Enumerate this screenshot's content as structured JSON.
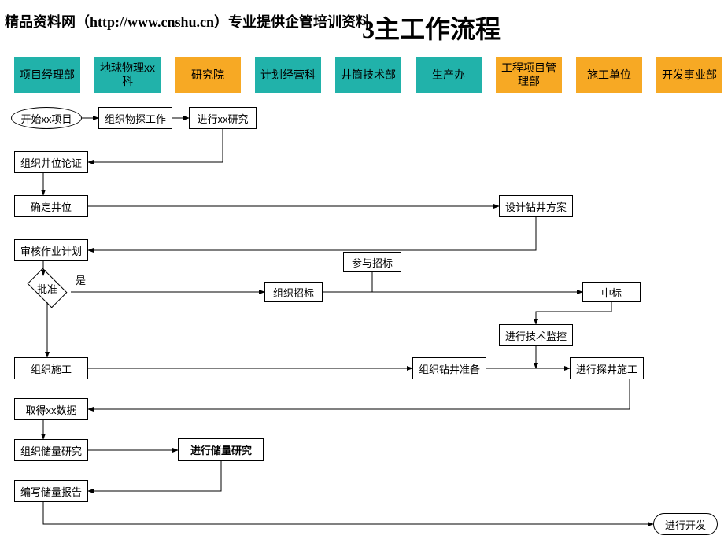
{
  "watermark": "精品资料网（http://www.cnshu.cn）专业提供企管培训资料",
  "title": "3主工作流程",
  "lanes": {
    "l0": "项目经理部",
    "l1": "地球物理xx科",
    "l2": "研究院",
    "l3": "计划经营科",
    "l4": "井筒技术部",
    "l5": "生产办",
    "l6": "工程项目管理部",
    "l7": "施工单位",
    "l8": "开发事业部"
  },
  "nodes": {
    "start": "开始xx项目",
    "n_phys": "组织物探工作",
    "n_study": "进行xx研究",
    "n_wellarg": "组织井位论证",
    "n_well": "确定井位",
    "n_design": "设计钻井方案",
    "n_audit": "审核作业计划",
    "n_approve": "批准",
    "yes": "是",
    "n_tender": "组织招标",
    "n_bid": "参与招标",
    "n_win": "中标",
    "n_monitor": "进行技术监控",
    "n_org_con": "组织施工",
    "n_drillprep": "组织钻井准备",
    "n_explore": "进行探井施工",
    "n_data": "取得xx数据",
    "n_reserve_org": "组织储量研究",
    "n_reserve_study": "进行储量研究",
    "n_report": "编写储量报告",
    "n_develop": "进行开发"
  }
}
